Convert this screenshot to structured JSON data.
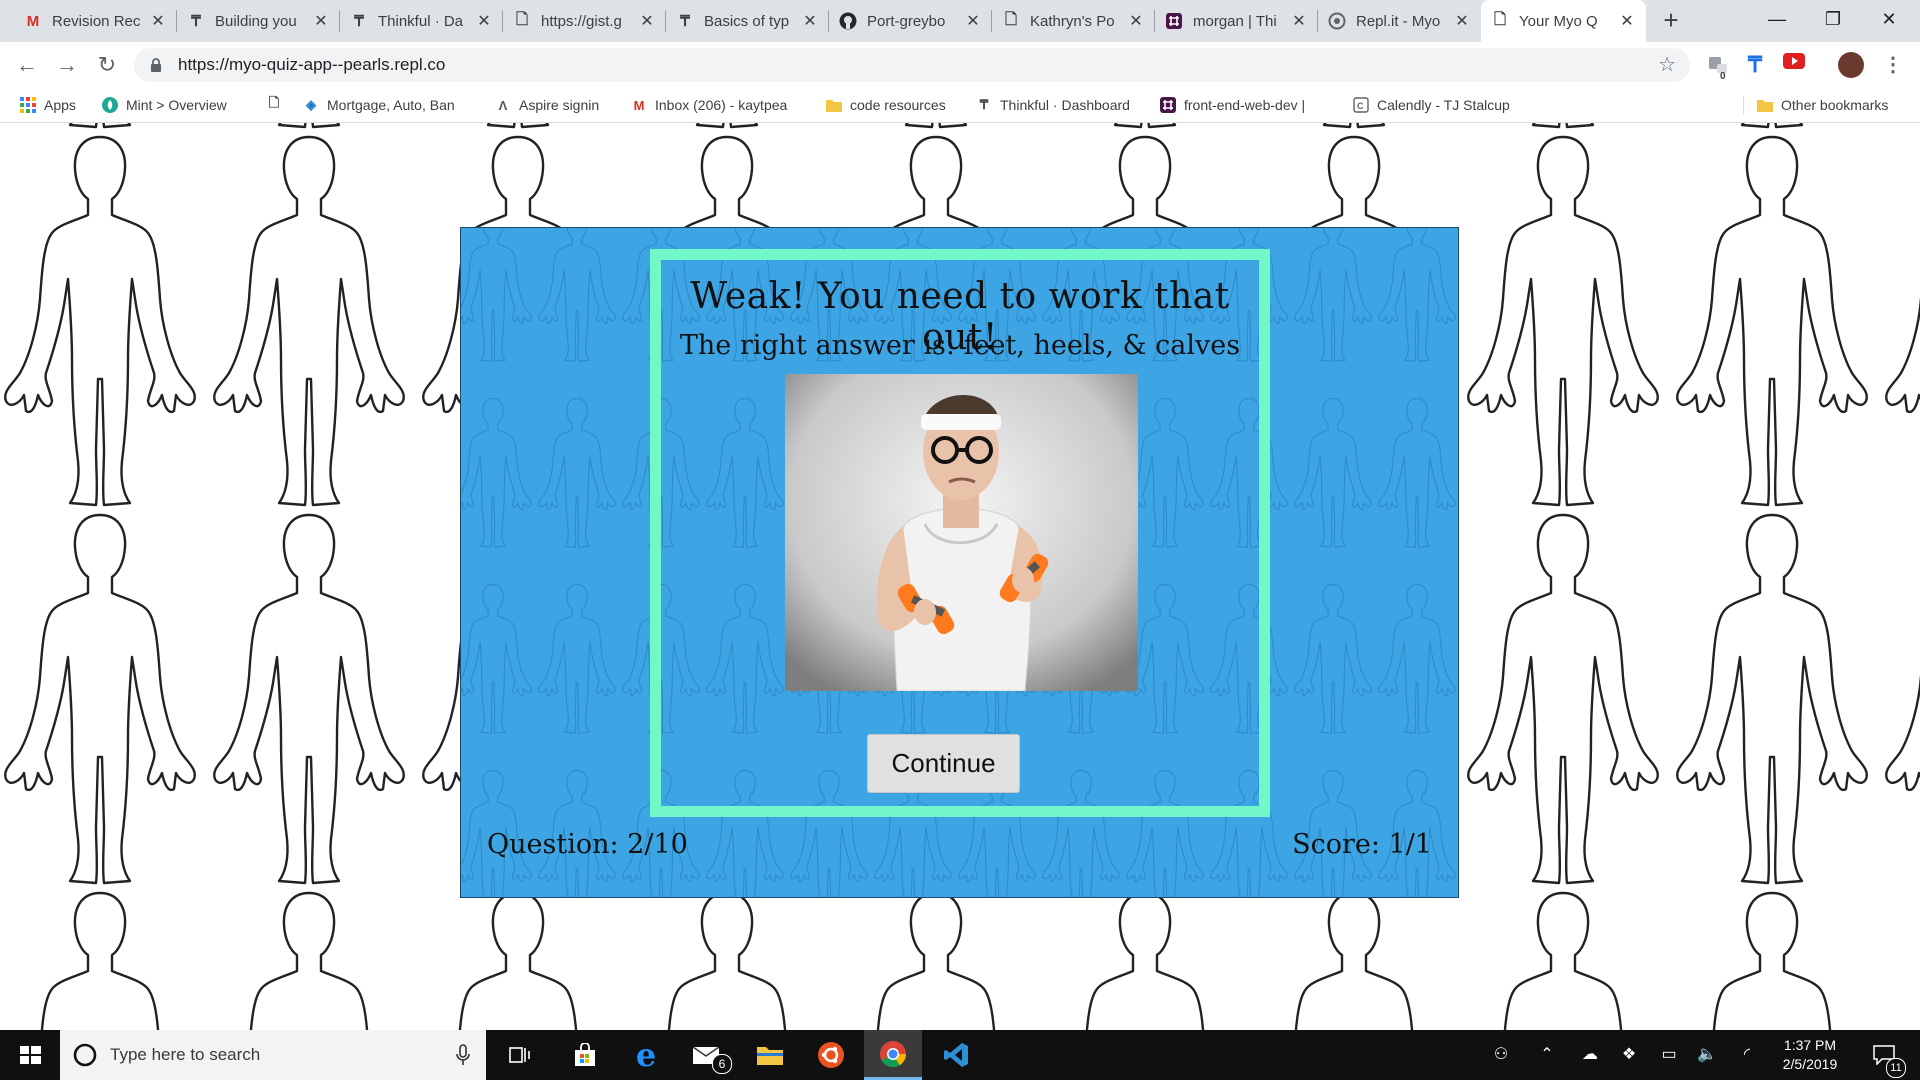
{
  "tabs": [
    {
      "title": "Revision Rec",
      "icon": "gmail-icon"
    },
    {
      "title": "Building you",
      "icon": "thinkful-icon"
    },
    {
      "title": "Thinkful · Da",
      "icon": "thinkful-icon"
    },
    {
      "title": "https://gist.g",
      "icon": "page-icon"
    },
    {
      "title": "Basics of typ",
      "icon": "thinkful-icon"
    },
    {
      "title": "Port-greybo",
      "icon": "github-icon"
    },
    {
      "title": "Kathryn's Po",
      "icon": "page-icon"
    },
    {
      "title": "morgan | Thi",
      "icon": "slack-icon"
    },
    {
      "title": "Repl.it - Myo",
      "icon": "replit-icon"
    },
    {
      "title": "Your Myo Q",
      "icon": "page-icon",
      "active": true
    }
  ],
  "browser": {
    "url": "https://myo-quiz-app--pearls.repl.co",
    "new_tab": "+",
    "ext_badge": "0"
  },
  "bookmarks": [
    {
      "label": "Apps",
      "icon": "apps-grid-icon"
    },
    {
      "label": "Mint > Overview",
      "icon": "mint-icon"
    },
    {
      "label": "",
      "icon": "page-icon"
    },
    {
      "label": "Mortgage, Auto, Ban",
      "icon": "chase-icon"
    },
    {
      "label": "Aspire signin",
      "icon": "aspire-icon"
    },
    {
      "label": "Inbox (206) - kaytpea",
      "icon": "gmail-icon"
    },
    {
      "label": "code resources",
      "icon": "folder-icon"
    },
    {
      "label": "Thinkful · Dashboard",
      "icon": "thinkful-icon"
    },
    {
      "label": "front-end-web-dev |",
      "icon": "slack-icon"
    },
    {
      "label": "Calendly - TJ Stalcup",
      "icon": "calendly-icon"
    },
    {
      "label": "Other bookmarks",
      "icon": "folder-icon"
    }
  ],
  "quiz": {
    "feedback_title": "Weak! You need to work that out!",
    "feedback_answer": "The right answer is: feet, heels, & calves",
    "continue_label": "Continue",
    "question_count": "Question: 2/10",
    "score": "Score: 1/1"
  },
  "taskbar": {
    "search_placeholder": "Type here to search",
    "mail_badge": "6",
    "time": "1:37 PM",
    "date": "2/5/2019",
    "notification_count": "11"
  },
  "colors": {
    "quiz_bg": "#3ea5e5",
    "feedback_border": "#72f7c9",
    "button_bg": "#e0e0e0"
  }
}
